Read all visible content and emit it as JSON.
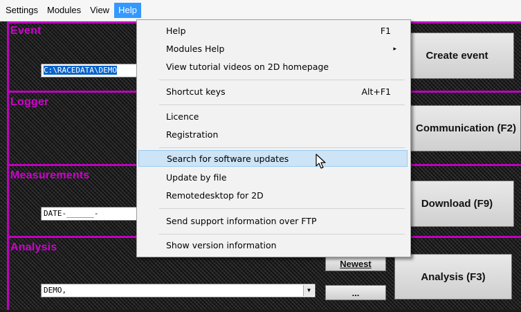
{
  "menubar": {
    "items": [
      {
        "label": "Settings"
      },
      {
        "label": "Modules"
      },
      {
        "label": "View"
      },
      {
        "label": "Help"
      }
    ]
  },
  "sections": {
    "event": {
      "title": "Event",
      "path_value": "C:\\RACEDATA\\DEMO",
      "button": "Create event"
    },
    "logger": {
      "title": "Logger",
      "button": "Communication (F2)"
    },
    "measurements": {
      "title": "Measurements",
      "value": "DATE-______-",
      "button": "Download (F9)"
    },
    "analysis": {
      "title": "Analysis",
      "value": "DEMO,",
      "button": "Analysis (F3)",
      "newest_button": "Newest",
      "browse_button": "..."
    }
  },
  "help_menu": {
    "items": [
      {
        "label": "Help",
        "shortcut": "F1"
      },
      {
        "label": "Modules Help",
        "submenu": "▸"
      },
      {
        "label": "View tutorial videos on 2D homepage"
      },
      {
        "label": "Shortcut keys",
        "shortcut": "Alt+F1"
      },
      {
        "label": "Licence"
      },
      {
        "label": "Registration"
      },
      {
        "label": "Search for software updates",
        "highlighted": true
      },
      {
        "label": "Update by file"
      },
      {
        "label": "Remotedesktop for 2D"
      },
      {
        "label": "Send support information over FTP"
      },
      {
        "label": "Show version information"
      }
    ]
  },
  "colors": {
    "accent": "#c000c0",
    "menu_active": "#3399ff",
    "menu_hover": "#cde4f7"
  }
}
